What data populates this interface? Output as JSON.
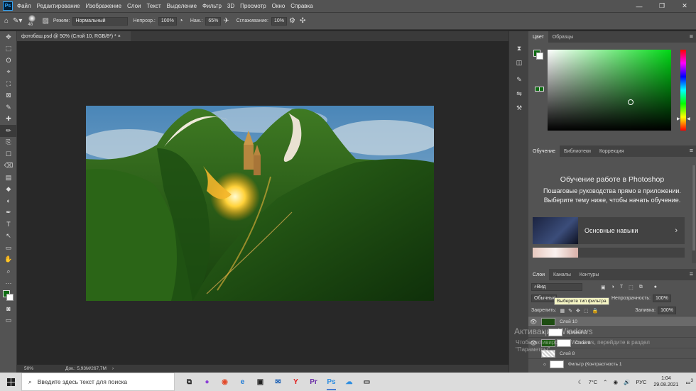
{
  "menu": {
    "logo": "Ps",
    "items": [
      "Файл",
      "Редактирование",
      "Изображение",
      "Слои",
      "Текст",
      "Выделение",
      "Фильтр",
      "3D",
      "Просмотр",
      "Окно",
      "Справка"
    ],
    "window_controls": [
      "—",
      "❐",
      "✕"
    ]
  },
  "options": {
    "brush_size": "48",
    "mode_label": "Режим:",
    "mode_value": "Нормальный",
    "opacity_label": "Непрозр.:",
    "opacity_value": "100%",
    "flow_label": "Наж.:",
    "flow_value": "65%",
    "smoothing_label": "Сглаживание:",
    "smoothing_value": "10%"
  },
  "document": {
    "tab_title": "фотобаш.psd @ 50% (Слой 10, RGB/8*) * ×",
    "zoom": "50%",
    "doc_info": "Док.: 5,93M/267,7M"
  },
  "tools": [
    "✥",
    "⬚",
    "ʘ",
    "⌖",
    "⛶",
    "⊠",
    "✎",
    "✚",
    "✏",
    "⎘",
    "☐",
    "⌫",
    "▤",
    "◆",
    "◐",
    "✒",
    "T",
    "↖",
    "▭",
    "✋",
    "⌕"
  ],
  "panels": {
    "color_tabs": [
      "Цвет",
      "Образцы"
    ],
    "learn_tabs": [
      "Обучение",
      "Библиотеки",
      "Коррекция"
    ],
    "learn_title": "Обучение работе в Photoshop",
    "learn_desc": "Пошаговые руководства прямо в приложении. Выберите тему ниже, чтобы начать обучение.",
    "learn_card": "Основные навыки",
    "layers_tabs": [
      "Слои",
      "Каналы",
      "Контуры"
    ],
    "filter_kind": "Вид",
    "blend_mode": "Обычные",
    "tooltip": "Выберите тип фильтра",
    "opacity_label": "Непрозрачность:",
    "opacity_value": "100%",
    "lock_label": "Закрепить:",
    "fill_label": "Заливка:",
    "fill_value": "100%",
    "layers": [
      {
        "name": "Слой 10"
      },
      {
        "name": "Кривые 2"
      },
      {
        "name": "Слой 9"
      },
      {
        "name": "Слой 8"
      },
      {
        "name": "Фильтр (Контрастность 1"
      }
    ],
    "layer_bottom_icons": [
      "fx",
      "◑",
      "▤",
      "⬚",
      "＋",
      "🗑"
    ]
  },
  "watermark": {
    "title": "Активация Windows",
    "line1": "Чтобы активировать Windows, перейдите в раздел",
    "line2": "\"Параметры\"."
  },
  "taskbar": {
    "search_placeholder": "Введите здесь текст для поиска",
    "apps": [
      "⧉",
      "●",
      "◉",
      "e",
      "▣",
      "✉",
      "Y",
      "Pr",
      "Ps",
      "☁",
      "▭"
    ],
    "weather": "7°C",
    "lang": "РУС",
    "time": "1:04",
    "date": "29.08.2021",
    "notifications": "3"
  },
  "colors": {
    "foreground": "#0e6b12",
    "background": "#ffffff",
    "accent": "#31a8ff"
  }
}
